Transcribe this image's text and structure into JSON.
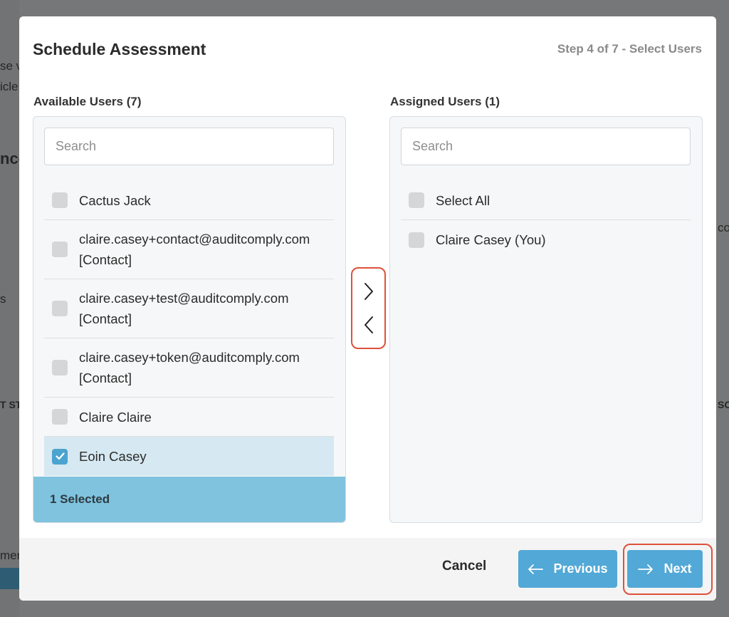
{
  "background": {
    "fragments": [
      "se v",
      "icle",
      "nce",
      "s",
      "T STA",
      "men",
      "con",
      "SCH"
    ]
  },
  "modal": {
    "title": "Schedule Assessment",
    "step": "Step 4 of 7 - Select Users"
  },
  "available": {
    "title": "Available Users (7)",
    "search_placeholder": "Search",
    "items": [
      {
        "line1": "Cactus Jack",
        "line2": "",
        "checked": false
      },
      {
        "line1": "claire.casey+contact@auditcomply.com",
        "line2": "[Contact]",
        "checked": false
      },
      {
        "line1": "claire.casey+test@auditcomply.com",
        "line2": "[Contact]",
        "checked": false
      },
      {
        "line1": "claire.casey+token@auditcomply.com",
        "line2": "[Contact]",
        "checked": false
      },
      {
        "line1": "Claire Claire",
        "line2": "",
        "checked": false
      },
      {
        "line1": "Eoin Casey",
        "line2": "",
        "checked": true
      }
    ],
    "selected_count": "1 Selected"
  },
  "assigned": {
    "title": "Assigned Users (1)",
    "search_placeholder": "Search",
    "select_all": "Select All",
    "items": [
      {
        "line1": "Claire Casey (You)",
        "checked": false
      }
    ]
  },
  "footer": {
    "cancel": "Cancel",
    "previous": "Previous",
    "next": "Next"
  },
  "colors": {
    "accent": "#52a8d6",
    "highlight_outline": "#e0513a",
    "selected_bar": "#7fc3df",
    "selected_row": "#d6e8f1"
  }
}
